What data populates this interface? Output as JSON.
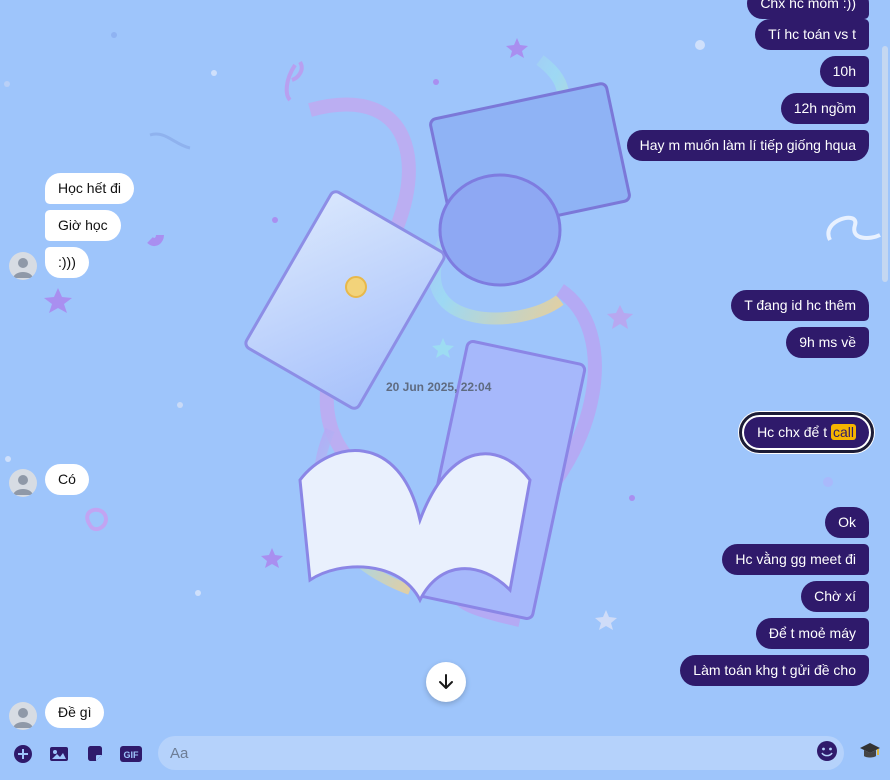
{
  "theme": {
    "bg": "#9ec5fb",
    "out_bubble": "#2f1a6b",
    "in_bubble": "#ffffff",
    "highlight": "#f5b400"
  },
  "messages": {
    "m0": "Chx hc mốm  :))",
    "m1": "Tí hc toán vs t",
    "m2": "10h",
    "m3": "12h ngồm",
    "m4": "Hay m muốn làm lí tiếp giống hqua",
    "m5": "Học hết đi",
    "m6": "Giờ học",
    "m7": ":)))",
    "m8": "T đang id hc thêm",
    "m9": "9h ms về",
    "m10_before": "Hc chx để t ",
    "m10_highlight": "call",
    "m11": "Có",
    "m12": "Ok",
    "m13": "Hc vằng gg meet đi",
    "m14": "Chờ xí",
    "m15": "Để t moẻ máy",
    "m16": "Làm toán khg t gửi đề cho",
    "m17": "Đề gì"
  },
  "timestamp": "20 Jun 2025, 22:04",
  "composer": {
    "placeholder": "Aa",
    "gif_label": "GIF",
    "icons": [
      "plus-circle-icon",
      "image-icon",
      "sticker-icon",
      "gif-icon",
      "emoji-icon",
      "graduation-cap-icon"
    ]
  }
}
